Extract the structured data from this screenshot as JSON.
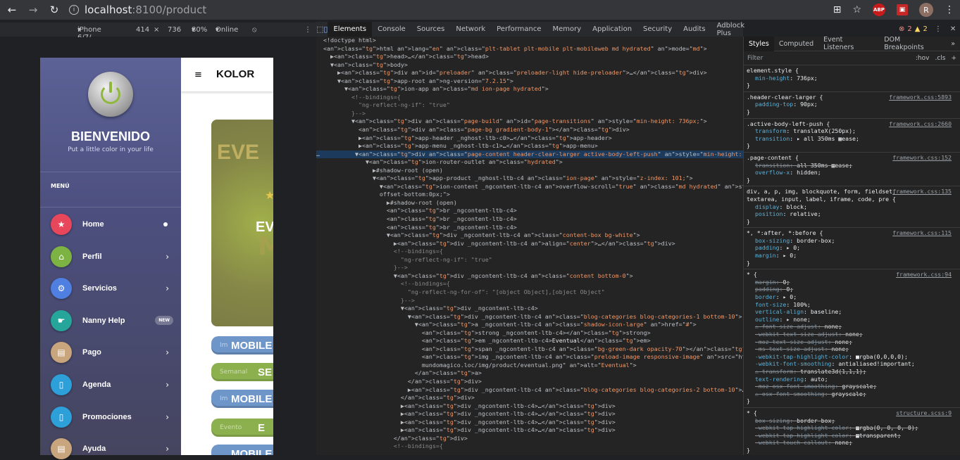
{
  "browser": {
    "url_host": "localhost",
    "url_rest": ":8100/product",
    "avatar_letter": "R",
    "abp_label": "ABP"
  },
  "device_toolbar": {
    "device": "iPhone 6/7/...",
    "width": "414",
    "times": "×",
    "height": "736",
    "zoom": "80%",
    "network": "Online"
  },
  "app": {
    "welcome": "BIENVENIDO",
    "tagline": "Put a little color in your life",
    "menu_label": "MENÚ",
    "header_title": "KOLOR",
    "menu_items": [
      {
        "label": "Home",
        "color": "#e8475b",
        "icon": "star-icon",
        "glyph": "★"
      },
      {
        "label": "Perfil",
        "color": "#7cb342",
        "icon": "home-icon",
        "glyph": "⌂"
      },
      {
        "label": "Servicios",
        "color": "#4f7fe0",
        "icon": "gear-icon",
        "glyph": "⚙"
      },
      {
        "label": "Nanny Help",
        "color": "#26a69a",
        "icon": "hand-icon",
        "glyph": "☛",
        "badge": "NEW"
      },
      {
        "label": "Pago",
        "color": "#c9a57d",
        "icon": "document-icon",
        "glyph": "▤"
      },
      {
        "label": "Agenda",
        "color": "#2d9fd9",
        "icon": "phone-icon",
        "glyph": "▯"
      },
      {
        "label": "Promociones",
        "color": "#2d9fd9",
        "icon": "phone-icon",
        "glyph": "▯"
      },
      {
        "label": "Ayuda",
        "color": "#c9a57d",
        "icon": "document-icon",
        "glyph": "▤"
      }
    ],
    "card_text_faded": "EVE",
    "card_text": "EV",
    "pills": [
      {
        "small": "Im",
        "big": "MOBILE",
        "style": "blue"
      },
      {
        "small": "Semanal",
        "big": "SE",
        "style": "green"
      },
      {
        "small": "Im",
        "big": "MOBILE",
        "style": "blue"
      },
      {
        "small": "Evento",
        "big": "E",
        "style": "green"
      },
      {
        "small": "",
        "big": "MOBILE",
        "style": "blue"
      }
    ]
  },
  "devtools": {
    "tabs": [
      "Elements",
      "Console",
      "Sources",
      "Network",
      "Performance",
      "Memory",
      "Application",
      "Security",
      "Audits",
      "Adblock Plus"
    ],
    "active_tab": "Elements",
    "errors": "2",
    "warnings": "2",
    "sidebar_tabs": [
      "Styles",
      "Computed",
      "Event Listeners",
      "DOM Breakpoints",
      "»"
    ],
    "filter_placeholder": "Filter",
    "hov": ":hov",
    "cls": ".cls",
    "plus": "+",
    "dom_lines": [
      {
        "indent": 0,
        "html": "<!doctype html>"
      },
      {
        "indent": 0,
        "html": "<html lang=\"en\" class=\"plt-tablet plt-mobile plt-mobileweb md hydrated\" mode=\"md\">"
      },
      {
        "indent": 1,
        "html": "▶<head>…</head>"
      },
      {
        "indent": 1,
        "html": "▼<body>"
      },
      {
        "indent": 2,
        "html": "▶<div id=\"preloader\" class=\"preloader-light hide-preloader\">…</div>"
      },
      {
        "indent": 2,
        "html": "▼<app-root ng-version=\"7.2.15\">"
      },
      {
        "indent": 3,
        "html": "▼<ion-app class=\"md ion-page hydrated\">"
      },
      {
        "indent": 4,
        "html": "<!--bindings={"
      },
      {
        "indent": 5,
        "html": "\"ng-reflect-ng-if\": \"true\""
      },
      {
        "indent": 4,
        "html": "}-->"
      },
      {
        "indent": 4,
        "html": "▼<div class=\"page-build\" id=\"page-transitions\" style=\"min-height: 736px;\">"
      },
      {
        "indent": 5,
        "html": "<div class=\"page-bg gradient-body-1\"></div>"
      },
      {
        "indent": 5,
        "html": "▶<app-header _nghost-ltb-c0>…</app-header>"
      },
      {
        "indent": 5,
        "html": "▶<app-menu _nghost-ltb-c1>…</app-menu>"
      },
      {
        "indent": 5,
        "html": "▼<div class=\"page-content header-clear-larger active-body-left-push\" style=\"min-height: 736px;\"> == $0",
        "selected": true
      },
      {
        "indent": 6,
        "html": "▼<ion-router-outlet class=\"hydrated\">"
      },
      {
        "indent": 7,
        "html": "▶#shadow-root (open)"
      },
      {
        "indent": 7,
        "html": "▼<app-product _nghost-ltb-c4 class=\"ion-page\" style=\"z-index: 101;\">"
      },
      {
        "indent": 8,
        "html": "▼<ion-content _ngcontent-ltb-c4 overflow-scroll=\"true\" class=\"md hydrated\" style=\"--offset-top:0px; --"
      },
      {
        "indent": 8,
        "html": "offset-bottom:0px;\">"
      },
      {
        "indent": 9,
        "html": "▶#shadow-root (open)"
      },
      {
        "indent": 9,
        "html": "<br _ngcontent-ltb-c4>"
      },
      {
        "indent": 9,
        "html": "<br _ngcontent-ltb-c4>"
      },
      {
        "indent": 9,
        "html": "<br _ngcontent-ltb-c4>"
      },
      {
        "indent": 9,
        "html": "▼<div _ngcontent-ltb-c4 class=\"content-box bg-white\">"
      },
      {
        "indent": 10,
        "html": "▶<div _ngcontent-ltb-c4 align=\"center\">…</div>"
      },
      {
        "indent": 10,
        "html": "<!--bindings={"
      },
      {
        "indent": 11,
        "html": "\"ng-reflect-ng-if\": \"true\""
      },
      {
        "indent": 10,
        "html": "}-->"
      },
      {
        "indent": 10,
        "html": "▼<div _ngcontent-ltb-c4 class=\"content bottom-0\">"
      },
      {
        "indent": 11,
        "html": "<!--bindings={"
      },
      {
        "indent": 12,
        "html": "\"ng-reflect-ng-for-of\": \"[object Object],[object Object\""
      },
      {
        "indent": 11,
        "html": "}-->"
      },
      {
        "indent": 11,
        "html": "▼<div _ngcontent-ltb-c4>"
      },
      {
        "indent": 12,
        "html": "▼<div _ngcontent-ltb-c4 class=\"blog-categories blog-categories-1 bottom-10\">"
      },
      {
        "indent": 13,
        "html": "▼<a _ngcontent-ltb-c4 class=\"shadow-icon-large\" href=\"#\">"
      },
      {
        "indent": 14,
        "html": "<strong _ngcontent-ltb-c4></strong>"
      },
      {
        "indent": 14,
        "html": "<em _ngcontent-ltb-c4>Eventual</em>"
      },
      {
        "indent": 14,
        "html": "<span _ngcontent-ltb-c4 class=\"bg-green-dark opacity-70\"></span>"
      },
      {
        "indent": 14,
        "html": "<img _ngcontent-ltb-c4 class=\"preload-image responsive-image\" src=\"http://api-"
      },
      {
        "indent": 14,
        "html": "mundomagico.loc/img/product/eventual.png\" alt=\"Eventual\">"
      },
      {
        "indent": 13,
        "html": "</a>"
      },
      {
        "indent": 12,
        "html": "</div>"
      },
      {
        "indent": 12,
        "html": "▶<div _ngcontent-ltb-c4 class=\"blog-categories blog-categories-2 bottom-10\">…</div>"
      },
      {
        "indent": 11,
        "html": "</div>"
      },
      {
        "indent": 11,
        "html": "▶<div _ngcontent-ltb-c4>…</div>"
      },
      {
        "indent": 11,
        "html": "▶<div _ngcontent-ltb-c4>…</div>"
      },
      {
        "indent": 11,
        "html": "▶<div _ngcontent-ltb-c4>…</div>"
      },
      {
        "indent": 11,
        "html": "▶<div _ngcontent-ltb-c4>…</div>"
      },
      {
        "indent": 10,
        "html": "</div>"
      },
      {
        "indent": 10,
        "html": "<!--bindings={"
      }
    ],
    "style_rules": [
      {
        "selector": "element.style {",
        "source": "",
        "props": [
          [
            "min-height",
            "736px;",
            false
          ]
        ]
      },
      {
        "selector": ".header-clear-larger {",
        "source": "framework.css:5893",
        "props": [
          [
            "padding-top",
            "90px;",
            false
          ]
        ]
      },
      {
        "selector": ".active-body-left-push {",
        "source": "framework.css:2660",
        "props": [
          [
            "transform",
            "translateX(250px);",
            false
          ],
          [
            "transition",
            "▸ all 350ms ▩ease;",
            false
          ]
        ]
      },
      {
        "selector": ".page-content {",
        "source": "framework.css:152",
        "props": [
          [
            "transition",
            "all 350ms ▩ease;",
            true
          ],
          [
            "overflow-x",
            "hidden;",
            false
          ]
        ]
      },
      {
        "selector": "div, a, p, img, blockquote, form, fieldset, textarea, input, label, iframe, code, pre {",
        "source": "framework.css:135",
        "props": [
          [
            "display",
            "block;",
            false
          ],
          [
            "position",
            "relative;",
            false
          ]
        ]
      },
      {
        "selector": "*, *:after, *:before {",
        "source": "framework.css:115",
        "props": [
          [
            "box-sizing",
            "border-box;",
            false
          ],
          [
            "padding",
            "▸ 0;",
            false
          ],
          [
            "margin",
            "▸ 0;",
            false
          ]
        ]
      },
      {
        "selector": "* {",
        "source": "framework.css:94",
        "props": [
          [
            "margin",
            "0;",
            true
          ],
          [
            "padding",
            "0;",
            true
          ],
          [
            "border",
            "▸ 0;",
            false
          ],
          [
            "font-size",
            "100%;",
            false
          ],
          [
            "vertical-align",
            "baseline;",
            false
          ],
          [
            "outline",
            "▸ none;",
            false
          ],
          [
            "⚠ font-size-adjust",
            "none;",
            true
          ],
          [
            "-webkit-text-size-adjust",
            "none;",
            true
          ],
          [
            "-moz-text-size-adjust",
            "none;",
            true
          ],
          [
            "-ms-text-size-adjust",
            "none;",
            true
          ],
          [
            "-webkit-tap-highlight-color",
            "■rgba(0,0,0,0);",
            false
          ],
          [
            "-webkit-font-smoothing",
            "antialiased!important;",
            false
          ],
          [
            "⚠ transform",
            "translate3d(1,1,1);",
            true
          ],
          [
            "text-rendering",
            "auto;",
            false
          ],
          [
            "-moz-osx-font-smoothing",
            "grayscale;",
            true
          ],
          [
            "⚠ osx-font-smoothing",
            "grayscale;",
            true
          ]
        ]
      },
      {
        "selector": "* {",
        "source": "structure.scss:9",
        "props": [
          [
            "box-sizing",
            "border-box;",
            true
          ],
          [
            "-webkit-tap-highlight-color",
            "■rgba(0, 0, 0, 0);",
            true
          ],
          [
            "-webkit-tap-highlight-color",
            "■transparent;",
            true
          ],
          [
            "-webkit-touch-callout",
            "none;",
            true
          ]
        ]
      }
    ]
  }
}
